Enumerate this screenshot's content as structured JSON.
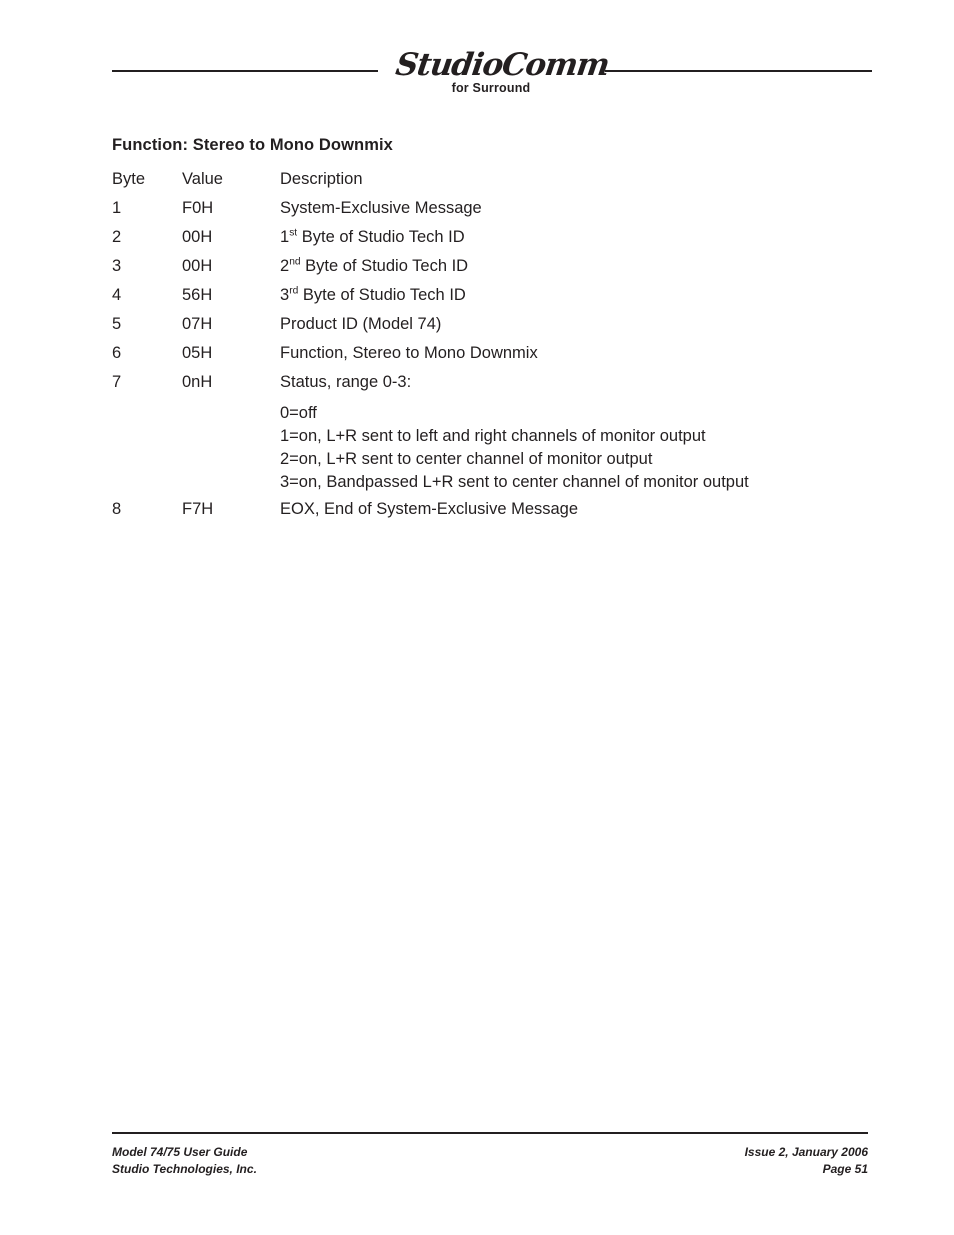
{
  "header": {
    "logo_script": "StudioComm",
    "logo_sub": "for Surround"
  },
  "section": {
    "title": "Function: Stereo to Mono Downmix"
  },
  "table": {
    "headers": {
      "byte": "Byte",
      "value": "Value",
      "description": "Description"
    },
    "rows": [
      {
        "byte": "1",
        "value": "F0H",
        "desc_pre": "System-Exclusive Message",
        "sup": "",
        "desc_post": ""
      },
      {
        "byte": "2",
        "value": "00H",
        "desc_pre": "1",
        "sup": "st",
        "desc_post": " Byte of Studio Tech ID"
      },
      {
        "byte": "3",
        "value": "00H",
        "desc_pre": "2",
        "sup": "nd",
        "desc_post": " Byte of Studio Tech ID"
      },
      {
        "byte": "4",
        "value": "56H",
        "desc_pre": "3",
        "sup": "rd",
        "desc_post": " Byte of Studio Tech ID"
      },
      {
        "byte": "5",
        "value": "07H",
        "desc_pre": "Product ID (Model 74)",
        "sup": "",
        "desc_post": ""
      },
      {
        "byte": "6",
        "value": "05H",
        "desc_pre": "Function, Stereo to Mono Downmix",
        "sup": "",
        "desc_post": ""
      },
      {
        "byte": "7",
        "value": "0nH",
        "desc_pre": "Status, range 0-3:",
        "sup": "",
        "desc_post": ""
      },
      {
        "byte": "8",
        "value": "F7H",
        "desc_pre": "EOX, End of System-Exclusive Message",
        "sup": "",
        "desc_post": ""
      }
    ],
    "status_options": [
      "0=off",
      "1=on, L+R sent to left and right channels of monitor output",
      "2=on, L+R sent to center channel of monitor output",
      "3=on, Bandpassed L+R sent to center channel of monitor output"
    ]
  },
  "footer": {
    "left_line1": "Model 74/75 User Guide",
    "left_line2": "Studio Technologies, Inc.",
    "right_line1": "Issue 2, January 2006",
    "right_line2": "Page 51"
  },
  "colors": {
    "text": "#231f20",
    "background": "#ffffff"
  }
}
